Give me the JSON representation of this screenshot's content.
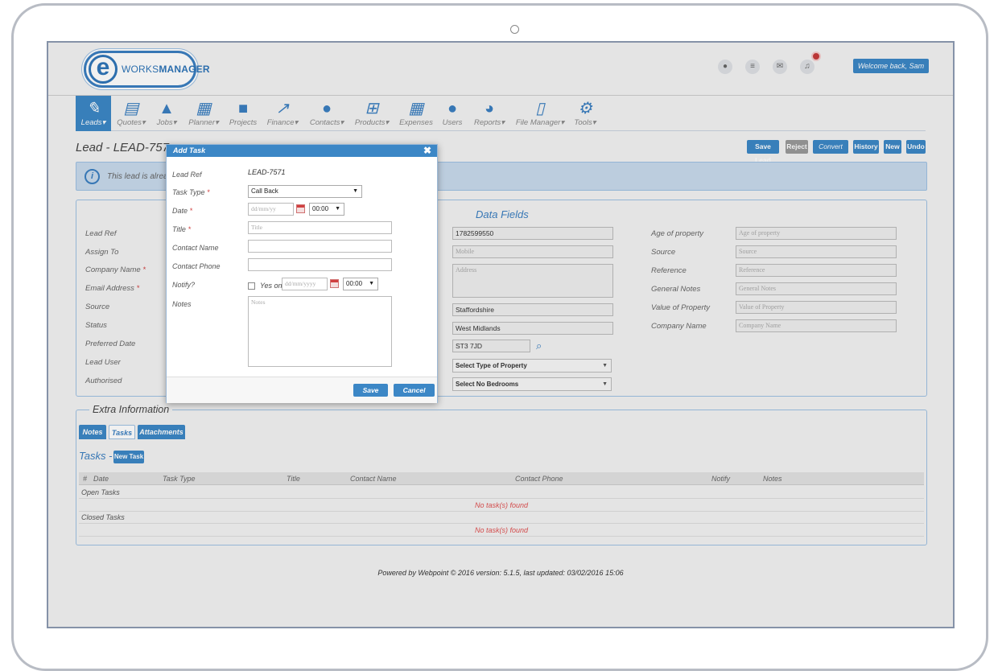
{
  "header": {
    "logo_text_light": "WORKS",
    "logo_text_bold": "MANAGER",
    "welcome": "Welcome back, Sam"
  },
  "nav": [
    {
      "label": "Leads▾",
      "icon": "pin-icon"
    },
    {
      "label": "Quotes▾",
      "icon": "document-icon"
    },
    {
      "label": "Jobs▾",
      "icon": "road-icon"
    },
    {
      "label": "Planner▾",
      "icon": "calendar-icon"
    },
    {
      "label": "Projects",
      "icon": "briefcase-icon"
    },
    {
      "label": "Finance▾",
      "icon": "line-chart-icon"
    },
    {
      "label": "Contacts▾",
      "icon": "chat-icon"
    },
    {
      "label": "Products▾",
      "icon": "cart-icon"
    },
    {
      "label": "Expenses",
      "icon": "calculator-icon"
    },
    {
      "label": "Users",
      "icon": "users-icon"
    },
    {
      "label": "Reports▾",
      "icon": "pie-chart-icon"
    },
    {
      "label": "File Manager▾",
      "icon": "pdf-file-icon"
    },
    {
      "label": "Tools▾",
      "icon": "gears-icon"
    }
  ],
  "page": {
    "title": "Lead - LEAD-757",
    "info_text": "This lead is alrea",
    "buttons": [
      "Save Lead",
      "Reject",
      "Convert",
      "History",
      "New",
      "Undo"
    ]
  },
  "form": {
    "left_labels": [
      "Lead Ref",
      "Assign To",
      "Company Name",
      "Email Address",
      "Source",
      "Status",
      "Preferred Date",
      "Lead User",
      "Authorised"
    ],
    "data_fields_title": "Data Fields",
    "phone_value": "1782599550",
    "mobile_placeholder": "Mobile",
    "address_placeholder": "Address",
    "county_value": "Staffordshire",
    "region_value": "West Midlands",
    "postcode_value": "ST3 7JD",
    "property_type_select": "Select Type of Property",
    "bedrooms_select": "Select No Bedrooms",
    "right_fields": [
      {
        "label": "Age of property",
        "placeholder": "Age of property"
      },
      {
        "label": "Source",
        "placeholder": "Source"
      },
      {
        "label": "Reference",
        "placeholder": "Reference"
      },
      {
        "label": "General Notes",
        "placeholder": "General Notes"
      },
      {
        "label": "Value of Property",
        "placeholder": "Value of Property"
      },
      {
        "label": "Company Name",
        "placeholder": "Company Name"
      }
    ]
  },
  "extra": {
    "legend": "Extra Information",
    "tabs": [
      "Notes",
      "Tasks",
      "Attachments"
    ],
    "tasks_title": "Tasks -",
    "new_task": "New Task",
    "columns": [
      "#",
      "Date",
      "Task Type",
      "Title",
      "Contact Name",
      "Contact Phone",
      "Notify",
      "Notes"
    ],
    "open_tasks": "Open Tasks",
    "closed_tasks": "Closed Tasks",
    "no_tasks": "No task(s) found"
  },
  "footer": "Powered by Webpoint © 2016 version: 5.1.5, last updated: 03/02/2016 15:06",
  "modal": {
    "title": "Add Task",
    "lead_ref_label": "Lead Ref",
    "lead_ref_value": "LEAD-7571",
    "task_type_label": "Task Type",
    "task_type_value": "Call Back",
    "date_label": "Date",
    "date_placeholder": "dd/mm/yy",
    "time_value": "00:00",
    "title_label": "Title",
    "title_placeholder": "Title",
    "contact_name_label": "Contact Name",
    "contact_phone_label": "Contact Phone",
    "notify_label": "Notify?",
    "yes_on": "Yes on",
    "notify_date_placeholder": "dd/mm/yyyy",
    "notify_time_value": "00:00",
    "notes_label": "Notes",
    "notes_placeholder": "Notes",
    "save": "Save",
    "cancel": "Cancel"
  }
}
